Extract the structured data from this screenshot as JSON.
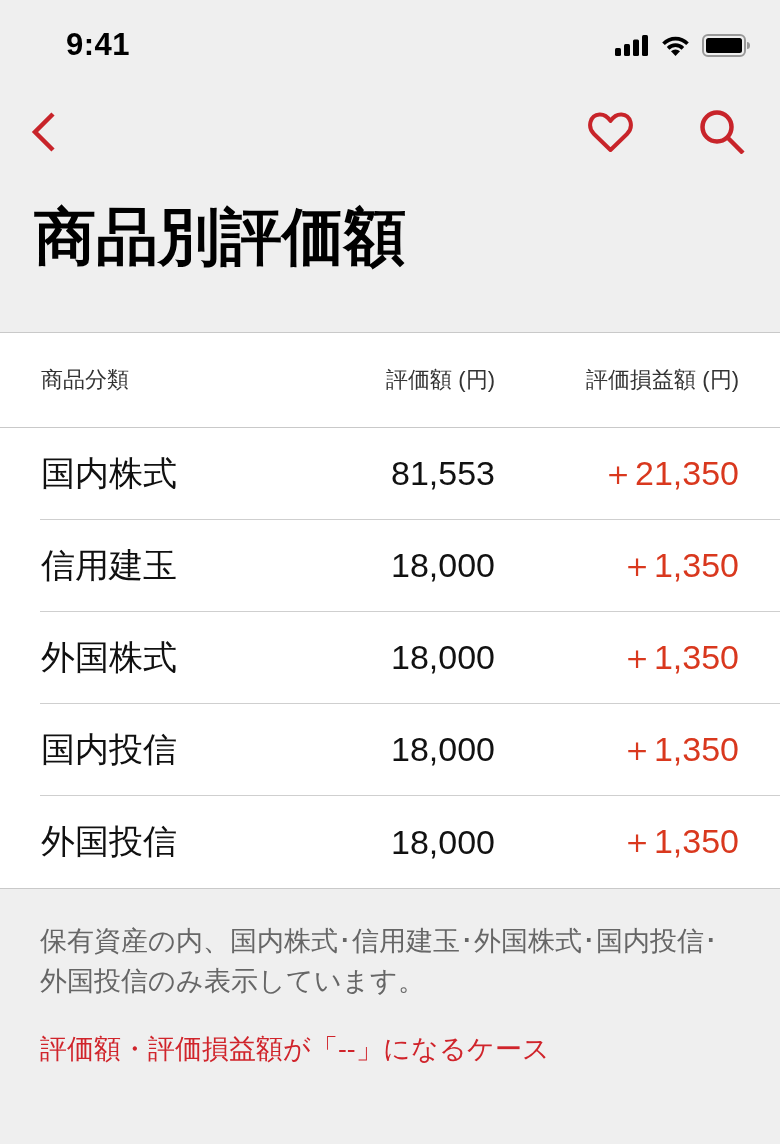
{
  "status_bar": {
    "time": "9:41"
  },
  "title": "商品別評価額",
  "table": {
    "columns": [
      "商品分類",
      "評価額 (円)",
      "評価損益額 (円)"
    ],
    "rows": [
      {
        "category": "国内株式",
        "value": "81,553",
        "gain": "＋21,350"
      },
      {
        "category": "信用建玉",
        "value": "18,000",
        "gain": "＋1,350"
      },
      {
        "category": "外国株式",
        "value": "18,000",
        "gain": "＋1,350"
      },
      {
        "category": "国内投信",
        "value": "18,000",
        "gain": "＋1,350"
      },
      {
        "category": "外国投信",
        "value": "18,000",
        "gain": "＋1,350"
      }
    ]
  },
  "note": "保有資産の内、国内株式･信用建玉･外国株式･国内投信･外国投信のみ表示しています。",
  "link": "評価額・評価損益額が「--」になるケース"
}
